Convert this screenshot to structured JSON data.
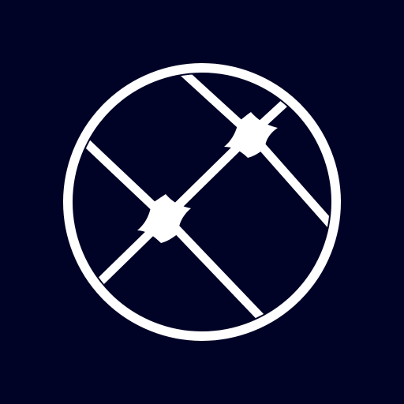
{
  "icon": {
    "name": "globe-grid-logo-icon",
    "background_color": "#000326",
    "foreground_color": "#ffffff"
  }
}
